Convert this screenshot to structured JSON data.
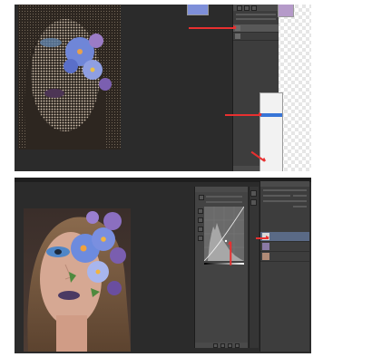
{
  "top_screen": {
    "layers": [
      "",
      ""
    ],
    "menu_items": [
      "",
      "",
      "",
      "",
      "",
      "",
      "",
      "",
      "",
      "",
      "",
      "",
      "",
      "",
      "",
      "",
      "",
      "",
      ""
    ],
    "selected_menu_index": 5
  },
  "bottom_screen": {
    "layers": [
      "",
      "",
      ""
    ],
    "selected_layer_index": 0,
    "tabs": [
      "",
      ""
    ]
  },
  "colors": {
    "arrow": "#e83030",
    "panel": "#3d3d3d",
    "canvas": "#2b2b2b",
    "menu_selected": "#3875d7"
  },
  "icons": [
    "layer-thumbnail-icon",
    "curves-icon",
    "pencil-icon",
    "eyedropper-icon",
    "trash-icon",
    "new-layer-icon"
  ]
}
